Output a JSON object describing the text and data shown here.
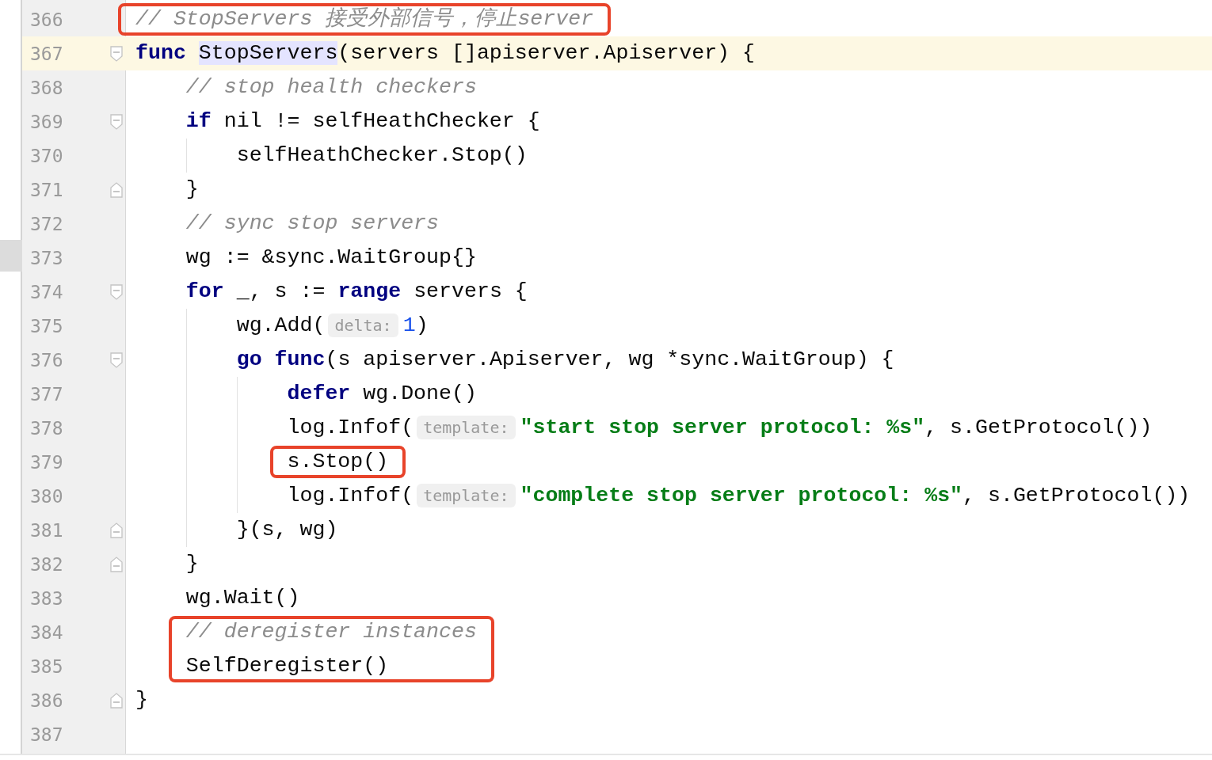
{
  "lines": [
    {
      "number": "366",
      "current": false,
      "marked": true,
      "tokens": [
        {
          "kind": "comment",
          "text": "// StopServers 接受外部信号，停止server"
        }
      ]
    },
    {
      "number": "367",
      "current": true,
      "marked": false,
      "fold": {
        "kind": "start",
        "expanded": true
      },
      "tokens": [
        {
          "kind": "keyword",
          "text": "func "
        },
        {
          "kind": "usage",
          "text": "StopServers"
        },
        {
          "kind": "plain",
          "text": "(servers []apiserver.Apiserver) {"
        }
      ]
    },
    {
      "number": "368",
      "current": false,
      "marked": false,
      "tokens": [
        {
          "kind": "comment",
          "text": "    // stop health checkers"
        }
      ]
    },
    {
      "number": "369",
      "current": false,
      "marked": false,
      "fold": {
        "kind": "start",
        "expanded": true
      },
      "tokens": [
        {
          "kind": "keyword",
          "text": "    if"
        },
        {
          "kind": "plain",
          "text": " nil != selfHeathChecker {"
        }
      ]
    },
    {
      "number": "370",
      "current": false,
      "marked": false,
      "tokens": [
        {
          "kind": "plain",
          "text": "        selfHeathChecker.Stop()"
        }
      ]
    },
    {
      "number": "371",
      "current": false,
      "marked": false,
      "fold": {
        "kind": "end",
        "expanded": true
      },
      "tokens": [
        {
          "kind": "plain",
          "text": "    }"
        }
      ]
    },
    {
      "number": "372",
      "current": false,
      "marked": false,
      "tokens": [
        {
          "kind": "comment",
          "text": "    // sync stop servers"
        }
      ]
    },
    {
      "number": "373",
      "current": false,
      "marked": false,
      "tokens": [
        {
          "kind": "plain",
          "text": "    wg := &sync.WaitGroup{}"
        }
      ]
    },
    {
      "number": "374",
      "current": false,
      "marked": false,
      "fold": {
        "kind": "start",
        "expanded": true
      },
      "tokens": [
        {
          "kind": "keyword",
          "text": "    for"
        },
        {
          "kind": "plain",
          "text": " _, s := "
        },
        {
          "kind": "keyword",
          "text": "range"
        },
        {
          "kind": "plain",
          "text": " servers {"
        }
      ]
    },
    {
      "number": "375",
      "current": false,
      "marked": false,
      "tokens": [
        {
          "kind": "plain",
          "text": "        wg.Add("
        },
        {
          "kind": "hint",
          "text": "delta:"
        },
        {
          "kind": "number",
          "text": "1"
        },
        {
          "kind": "plain",
          "text": ")"
        }
      ]
    },
    {
      "number": "376",
      "current": false,
      "marked": false,
      "fold": {
        "kind": "start",
        "expanded": true
      },
      "tokens": [
        {
          "kind": "keyword",
          "text": "        go "
        },
        {
          "kind": "keyword",
          "text": "func"
        },
        {
          "kind": "plain",
          "text": "(s apiserver.Apiserver, wg *sync.WaitGroup) {"
        }
      ]
    },
    {
      "number": "377",
      "current": false,
      "marked": false,
      "tokens": [
        {
          "kind": "keyword",
          "text": "            defer"
        },
        {
          "kind": "plain",
          "text": " wg.Done()"
        }
      ]
    },
    {
      "number": "378",
      "current": false,
      "marked": false,
      "tokens": [
        {
          "kind": "plain",
          "text": "            log.Infof("
        },
        {
          "kind": "hint",
          "text": "template:"
        },
        {
          "kind": "string",
          "text": "\"start stop server protocol: %s\""
        },
        {
          "kind": "plain",
          "text": ", s.GetProtocol())"
        }
      ]
    },
    {
      "number": "379",
      "current": false,
      "marked": true,
      "tokens": [
        {
          "kind": "plain",
          "text": "            s.Stop()"
        }
      ]
    },
    {
      "number": "380",
      "current": false,
      "marked": false,
      "tokens": [
        {
          "kind": "plain",
          "text": "            log.Infof("
        },
        {
          "kind": "hint",
          "text": "template:"
        },
        {
          "kind": "string",
          "text": "\"complete stop server protocol: %s\""
        },
        {
          "kind": "plain",
          "text": ", s.GetProtocol())"
        }
      ]
    },
    {
      "number": "381",
      "current": false,
      "marked": false,
      "fold": {
        "kind": "end",
        "expanded": true
      },
      "tokens": [
        {
          "kind": "plain",
          "text": "        }(s, wg)"
        }
      ]
    },
    {
      "number": "382",
      "current": false,
      "marked": false,
      "fold": {
        "kind": "end",
        "expanded": true
      },
      "tokens": [
        {
          "kind": "plain",
          "text": "    }"
        }
      ]
    },
    {
      "number": "383",
      "current": false,
      "marked": false,
      "tokens": [
        {
          "kind": "plain",
          "text": "    wg.Wait()"
        }
      ]
    },
    {
      "number": "384",
      "current": false,
      "marked": true,
      "tokens": [
        {
          "kind": "comment",
          "text": "    // deregister instances"
        }
      ]
    },
    {
      "number": "385",
      "current": false,
      "marked": true,
      "tokens": [
        {
          "kind": "plain",
          "text": "    SelfDeregister()"
        }
      ]
    },
    {
      "number": "386",
      "current": false,
      "marked": false,
      "fold": {
        "kind": "end",
        "expanded": true
      },
      "tokens": [
        {
          "kind": "plain",
          "text": "}"
        }
      ]
    },
    {
      "number": "387",
      "current": false,
      "marked": false
    }
  ]
}
